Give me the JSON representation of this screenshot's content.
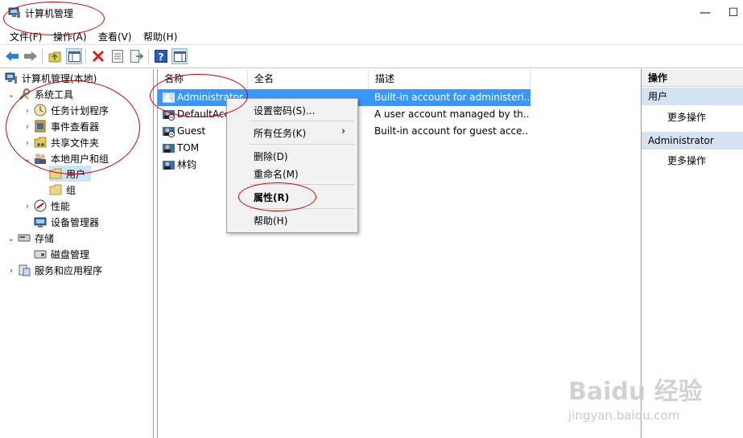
{
  "window": {
    "title": "计算机管理",
    "controls": {
      "minimize": "—",
      "maximize": "☐"
    }
  },
  "menubar": [
    "文件(F)",
    "操作(A)",
    "查看(V)",
    "帮助(H)"
  ],
  "tree": {
    "root": "计算机管理(本地)",
    "system_tools": "系统工具",
    "task_scheduler": "任务计划程序",
    "event_viewer": "事件查看器",
    "shared_folders": "共享文件夹",
    "local_users_groups": "本地用户和组",
    "users": "用户",
    "groups": "组",
    "performance": "性能",
    "device_manager": "设备管理器",
    "storage": "存储",
    "disk_management": "磁盘管理",
    "services_apps": "服务和应用程序"
  },
  "table": {
    "headers": {
      "name": "名称",
      "full_name": "全名",
      "description": "描述"
    },
    "rows": [
      {
        "name": "Administrator",
        "description": "Built-in account for administeri..."
      },
      {
        "name": "DefaultAcc",
        "description": "A user account managed by th..."
      },
      {
        "name": "Guest",
        "description": "Built-in account for guest acce..."
      },
      {
        "name": "TOM",
        "description": ""
      },
      {
        "name": "林钧",
        "description": ""
      }
    ]
  },
  "actions_pane": {
    "header": "操作",
    "group1": "用户",
    "more1": "更多操作",
    "group2": "Administrator",
    "more2": "更多操作"
  },
  "context_menu": {
    "set_password": "设置密码(S)...",
    "all_tasks": "所有任务(K)",
    "delete": "删除(D)",
    "rename": "重命名(M)",
    "properties": "属性(R)",
    "help": "帮助(H)"
  },
  "watermark": {
    "brand": "Baidu 经验",
    "url": "jingyan.baidu.com"
  },
  "colors": {
    "selection": "#3399ff",
    "annotation": "#cc0000",
    "section_header": "#d5e2f2"
  }
}
